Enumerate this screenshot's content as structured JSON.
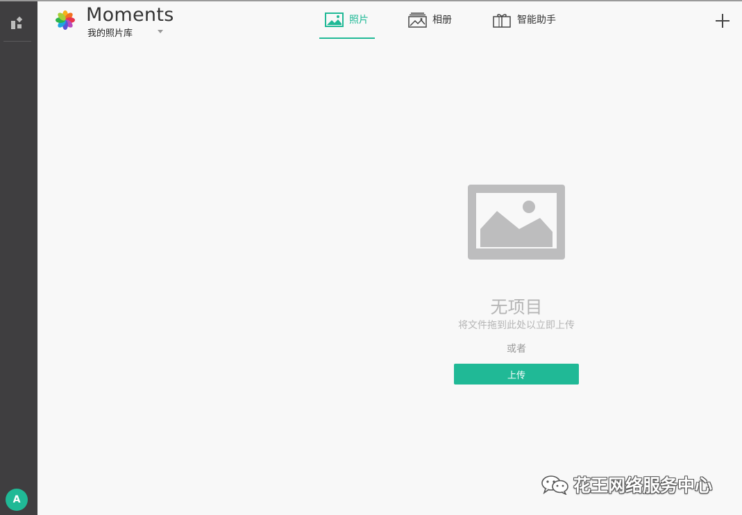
{
  "app": {
    "title": "Moments",
    "library_name": "我的照片库"
  },
  "sidebar": {
    "apps_icon": "apps-grid-icon",
    "user_initial": "A"
  },
  "tabs": [
    {
      "label": "照片",
      "icon": "photo-icon",
      "active": true
    },
    {
      "label": "相册",
      "icon": "album-icon",
      "active": false
    },
    {
      "label": "智能助手",
      "icon": "gift-icon",
      "active": false
    }
  ],
  "toolbar": {
    "add_icon": "plus-icon"
  },
  "empty_state": {
    "title": "无项目",
    "subtitle": "将文件拖到此处以立即上传",
    "or_text": "或者",
    "upload_label": "上传",
    "icon": "image-placeholder-icon"
  },
  "watermark": {
    "text": "花王网络服务中心"
  },
  "colors": {
    "accent": "#20b996",
    "sidebar": "#3f3e40",
    "background": "#f8f8f8",
    "muted_text": "#b5b5b5"
  }
}
